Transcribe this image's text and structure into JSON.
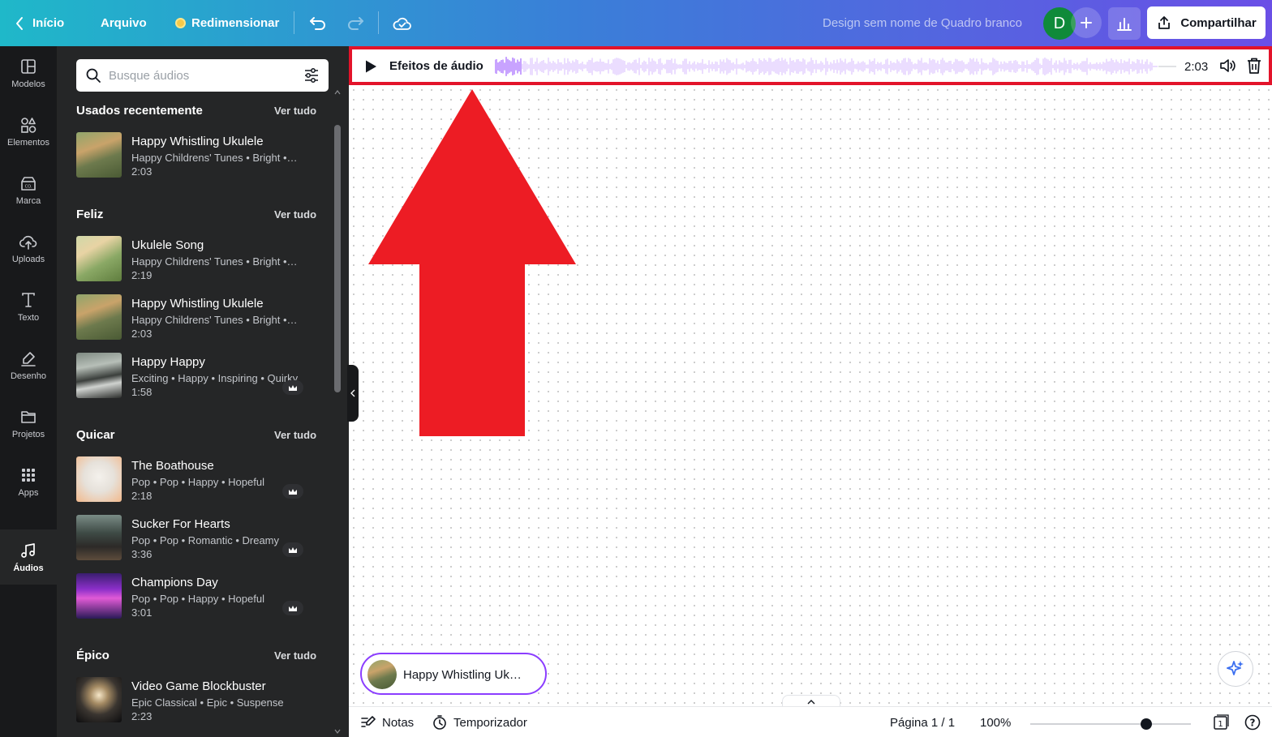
{
  "topbar": {
    "back_label": "Início",
    "file_label": "Arquivo",
    "resize_label": "Redimensionar",
    "design_title": "Design sem nome de Quadro branco",
    "avatar_initial": "D",
    "share_label": "Compartilhar",
    "icons": [
      "chevron-left-icon",
      "undo-icon",
      "redo-icon",
      "cloud-check-icon",
      "plus-icon",
      "bar-chart-icon",
      "share-upload-icon"
    ]
  },
  "rail": {
    "items": [
      {
        "label": "Modelos",
        "icon": "templates-icon"
      },
      {
        "label": "Elementos",
        "icon": "elements-icon"
      },
      {
        "label": "Marca",
        "icon": "brand-icon"
      },
      {
        "label": "Uploads",
        "icon": "upload-cloud-icon"
      },
      {
        "label": "Texto",
        "icon": "text-icon"
      },
      {
        "label": "Desenho",
        "icon": "draw-icon"
      },
      {
        "label": "Projetos",
        "icon": "folder-icon"
      },
      {
        "label": "Apps",
        "icon": "apps-grid-icon"
      },
      {
        "label": "Áudios",
        "icon": "music-note-icon",
        "active": true
      }
    ]
  },
  "panel": {
    "search_placeholder": "Busque áudios",
    "see_all": "Ver tudo",
    "sections": [
      {
        "title": "Usados recentemente",
        "tracks": [
          {
            "title": "Happy Whistling Ukulele",
            "tags": "Happy Childrens' Tunes • Bright •…",
            "duration": "2:03",
            "premium": false
          }
        ]
      },
      {
        "title": "Feliz",
        "tracks": [
          {
            "title": "Ukulele Song",
            "tags": "Happy Childrens' Tunes • Bright •…",
            "duration": "2:19",
            "premium": false
          },
          {
            "title": "Happy Whistling Ukulele",
            "tags": "Happy Childrens' Tunes • Bright •…",
            "duration": "2:03",
            "premium": false
          },
          {
            "title": "Happy Happy",
            "tags": "Exciting • Happy • Inspiring • Quirky",
            "duration": "1:58",
            "premium": true
          }
        ]
      },
      {
        "title": "Quicar",
        "tracks": [
          {
            "title": "The Boathouse",
            "tags": "Pop • Pop • Happy • Hopeful",
            "duration": "2:18",
            "premium": true
          },
          {
            "title": "Sucker For Hearts",
            "tags": "Pop • Pop • Romantic • Dreamy",
            "duration": "3:36",
            "premium": true
          },
          {
            "title": "Champions Day",
            "tags": "Pop • Pop • Happy • Hopeful",
            "duration": "3:01",
            "premium": true
          }
        ]
      },
      {
        "title": "Épico",
        "tracks": [
          {
            "title": "Video Game Blockbuster",
            "tags": "Epic Classical • Epic • Suspense",
            "duration": "2:23",
            "premium": false
          }
        ]
      }
    ]
  },
  "audio_bar": {
    "label": "Efeitos de áudio",
    "time": "2:03",
    "waveform_color": "#8b3dff",
    "highlight_color": "#e3132a"
  },
  "canvas": {
    "audio_pill_label": "Happy Whistling Uk…",
    "arrow_color": "#ed1c24"
  },
  "bottombar": {
    "notes_label": "Notas",
    "timer_label": "Temporizador",
    "page_label": "Página 1 / 1",
    "zoom_label": "100%",
    "page_count": "1",
    "help_label": "?",
    "zoom_fraction": 0.72
  }
}
